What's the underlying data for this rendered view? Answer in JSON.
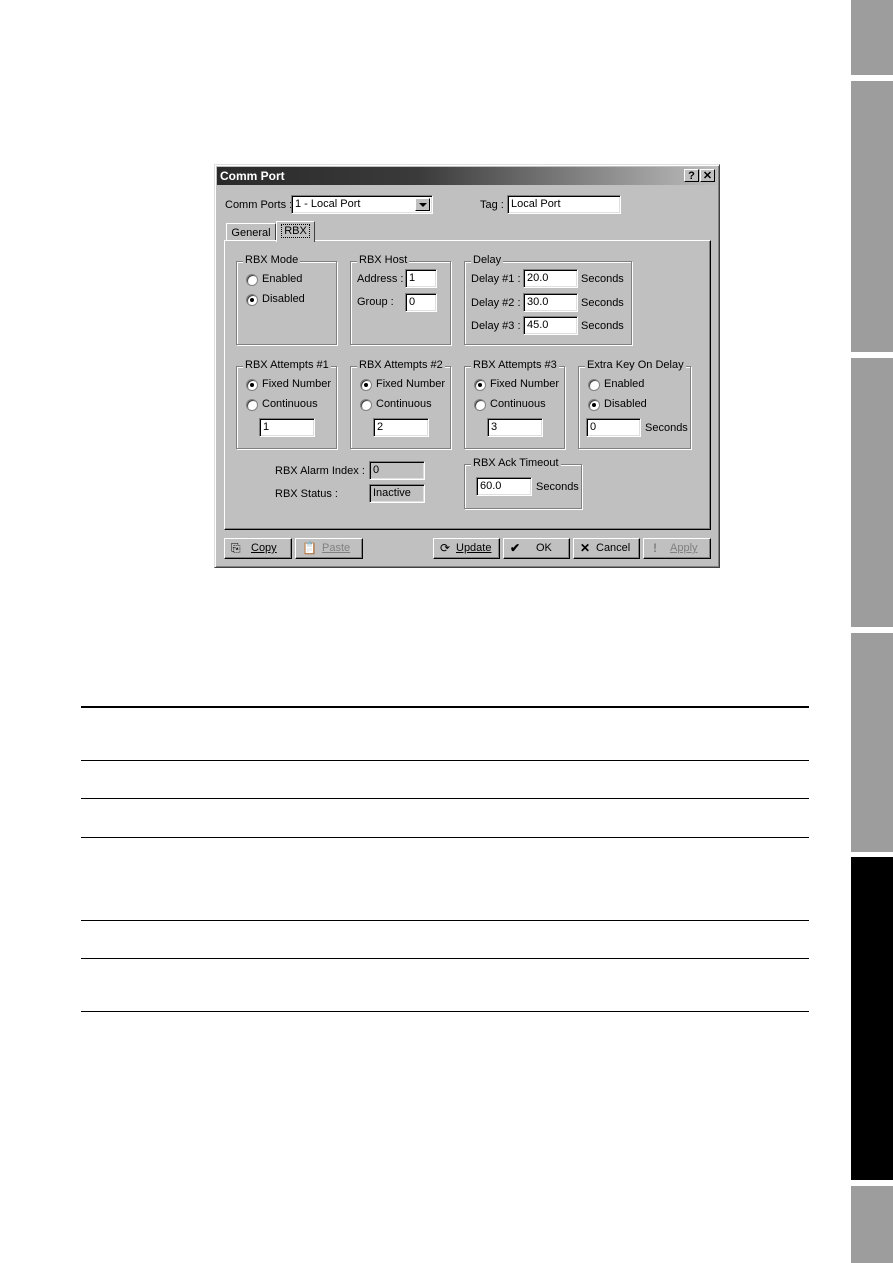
{
  "side_tabs": [
    {
      "name": "tab-1",
      "active": false
    },
    {
      "name": "tab-2",
      "active": false
    },
    {
      "name": "tab-3",
      "active": false
    },
    {
      "name": "tab-4",
      "active": false
    },
    {
      "name": "tab-5",
      "active": true
    },
    {
      "name": "tab-6",
      "active": false
    }
  ],
  "dialog": {
    "title": "Comm Port",
    "help_button": "?",
    "close_button": "✕",
    "comm_ports_label": "Comm Ports :",
    "comm_ports_value": "1 - Local Port",
    "tag_label": "Tag :",
    "tag_value": "Local Port",
    "tabs": [
      "General",
      "RBX"
    ],
    "active_tab": "RBX",
    "rbx_mode": {
      "title": "RBX Mode",
      "options": [
        "Enabled",
        "Disabled"
      ],
      "selected": "Disabled"
    },
    "rbx_host": {
      "title": "RBX Host",
      "address_label": "Address :",
      "address_value": "1",
      "group_label": "Group :",
      "group_value": "0"
    },
    "delay": {
      "title": "Delay",
      "rows": [
        {
          "label": "Delay #1 :",
          "value": "20.0",
          "unit": "Seconds"
        },
        {
          "label": "Delay #2 :",
          "value": "30.0",
          "unit": "Seconds"
        },
        {
          "label": "Delay #3 :",
          "value": "45.0",
          "unit": "Seconds"
        }
      ]
    },
    "attempts": [
      {
        "title": "RBX Attempts #1",
        "options": [
          "Fixed Number",
          "Continuous"
        ],
        "selected": "Fixed Number",
        "value": "1"
      },
      {
        "title": "RBX Attempts #2",
        "options": [
          "Fixed Number",
          "Continuous"
        ],
        "selected": "Fixed Number",
        "value": "2"
      },
      {
        "title": "RBX Attempts #3",
        "options": [
          "Fixed Number",
          "Continuous"
        ],
        "selected": "Fixed Number",
        "value": "3"
      }
    ],
    "extra_key": {
      "title": "Extra Key On Delay",
      "options": [
        "Enabled",
        "Disabled"
      ],
      "selected": "Disabled",
      "value": "0",
      "unit": "Seconds"
    },
    "alarm_index_label": "RBX Alarm Index :",
    "alarm_index_value": "0",
    "status_label": "RBX Status :",
    "status_value": "Inactive",
    "ack_timeout": {
      "title": "RBX Ack Timeout",
      "value": "60.0",
      "unit": "Seconds"
    },
    "buttons": {
      "copy": "Copy",
      "paste": "Paste",
      "update": "Update",
      "ok": "OK",
      "cancel": "Cancel",
      "apply": "Apply"
    }
  }
}
